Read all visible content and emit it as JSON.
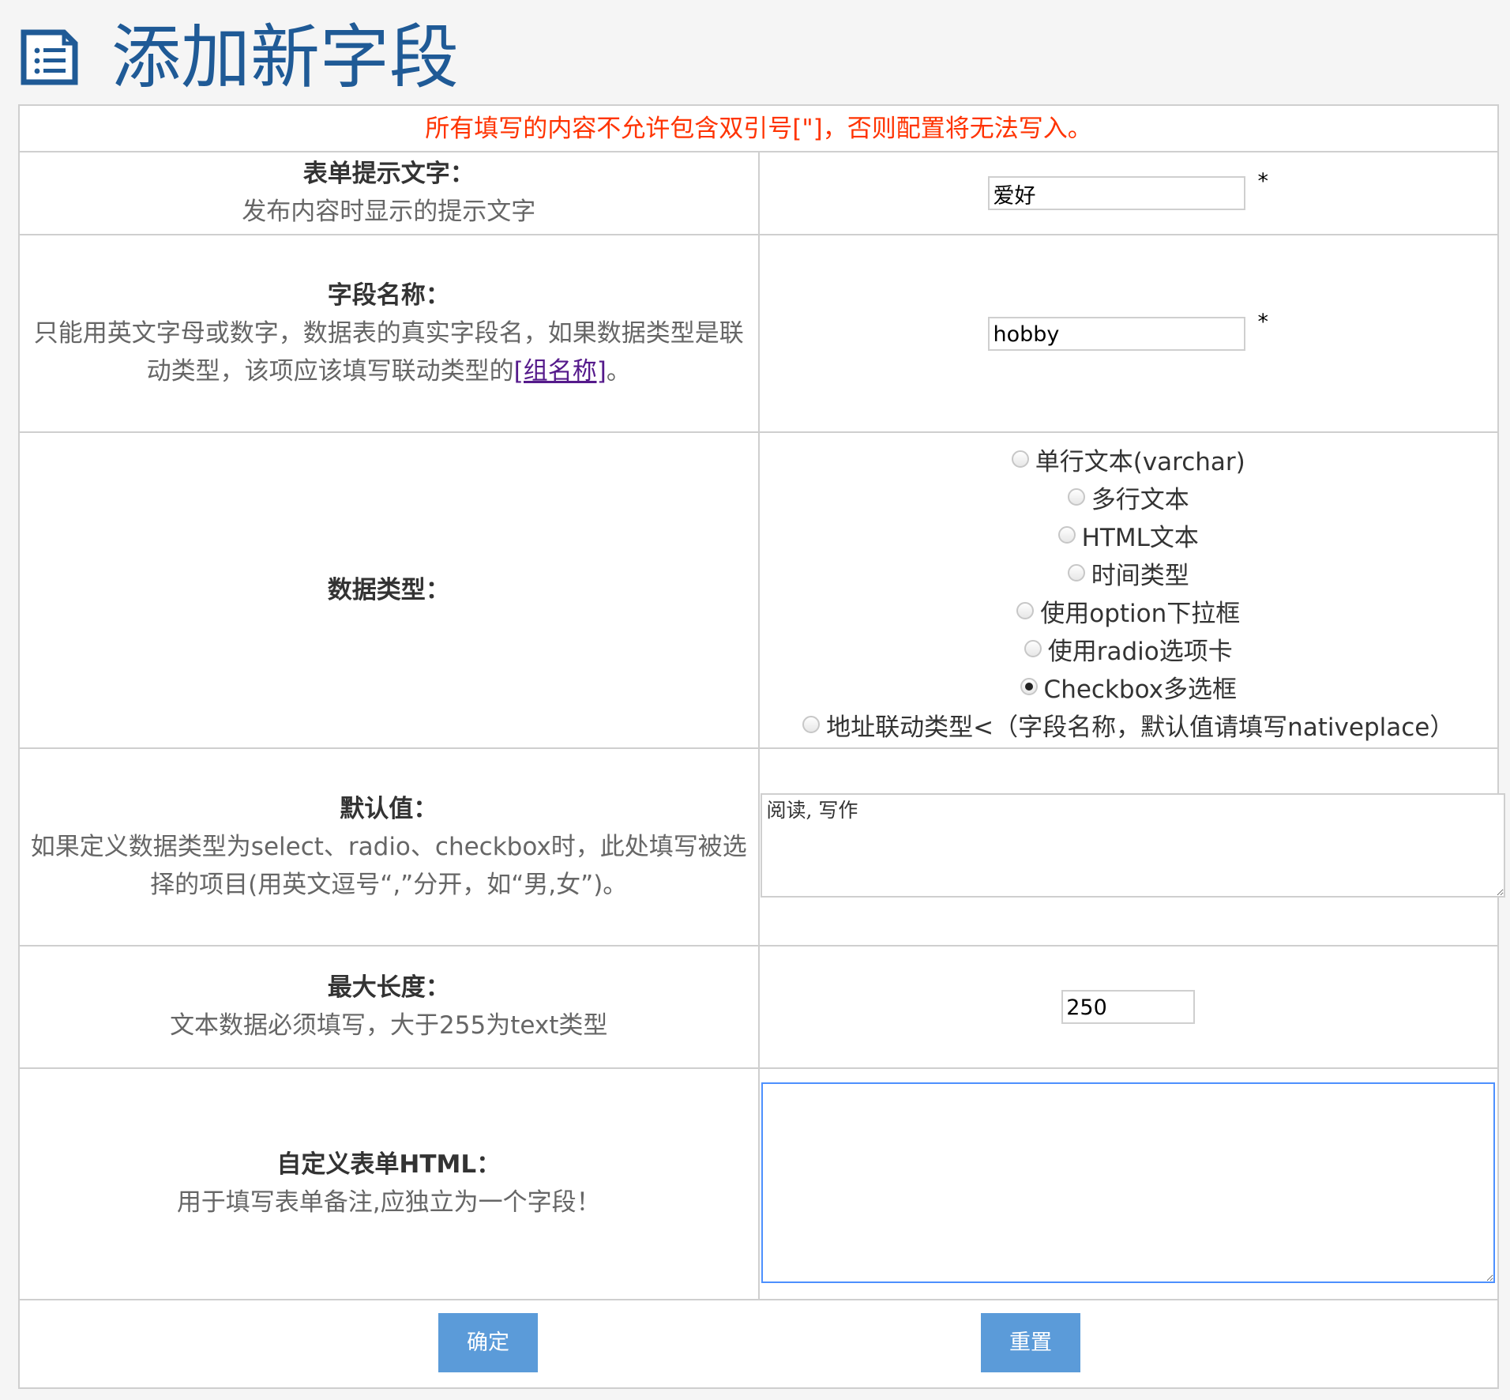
{
  "page": {
    "title": "添加新字段",
    "notice": "所有填写的内容不允许包含双引号[\"]，否则配置将无法写入。"
  },
  "icons": {
    "document": "document-list-icon"
  },
  "colors": {
    "title": "#1f5a96",
    "notice": "#ff3300",
    "button": "#5b9bd9",
    "focus_border": "#4d90fe"
  },
  "fields": {
    "label_text": {
      "title": "表单提示文字：",
      "description": "发布内容时显示的提示文字",
      "value": "爱好",
      "required": "*"
    },
    "field_name": {
      "title": "字段名称：",
      "description_part1": "只能用英文字母或数字，数据表的真实字段名，如果数据类型是联动类型，该项应该填写联动类型的",
      "link_text": "[组名称]",
      "description_part2": "。",
      "value": "hobby",
      "required": "*"
    },
    "data_type": {
      "title": "数据类型：",
      "options": [
        {
          "label": "单行文本(varchar)",
          "checked": false
        },
        {
          "label": "多行文本",
          "checked": false
        },
        {
          "label": "HTML文本",
          "checked": false
        },
        {
          "label": "时间类型",
          "checked": false
        },
        {
          "label": "使用option下拉框",
          "checked": false
        },
        {
          "label": "使用radio选项卡",
          "checked": false
        },
        {
          "label": "Checkbox多选框",
          "checked": true
        },
        {
          "label": "地址联动类型<（字段名称，默认值请填写nativeplace）",
          "checked": false
        }
      ]
    },
    "default_value": {
      "title": "默认值：",
      "description": "如果定义数据类型为select、radio、checkbox时，此处填写被选择的项目(用英文逗号“,”分开，如“男,女”)。",
      "value": "阅读, 写作"
    },
    "max_length": {
      "title": "最大长度：",
      "description": "文本数据必须填写，大于255为text类型",
      "value": "250"
    },
    "custom_html": {
      "title": "自定义表单HTML：",
      "description": "用于填写表单备注,应独立为一个字段！",
      "value": ""
    }
  },
  "actions": {
    "confirm": "确定",
    "reset": "重置"
  }
}
